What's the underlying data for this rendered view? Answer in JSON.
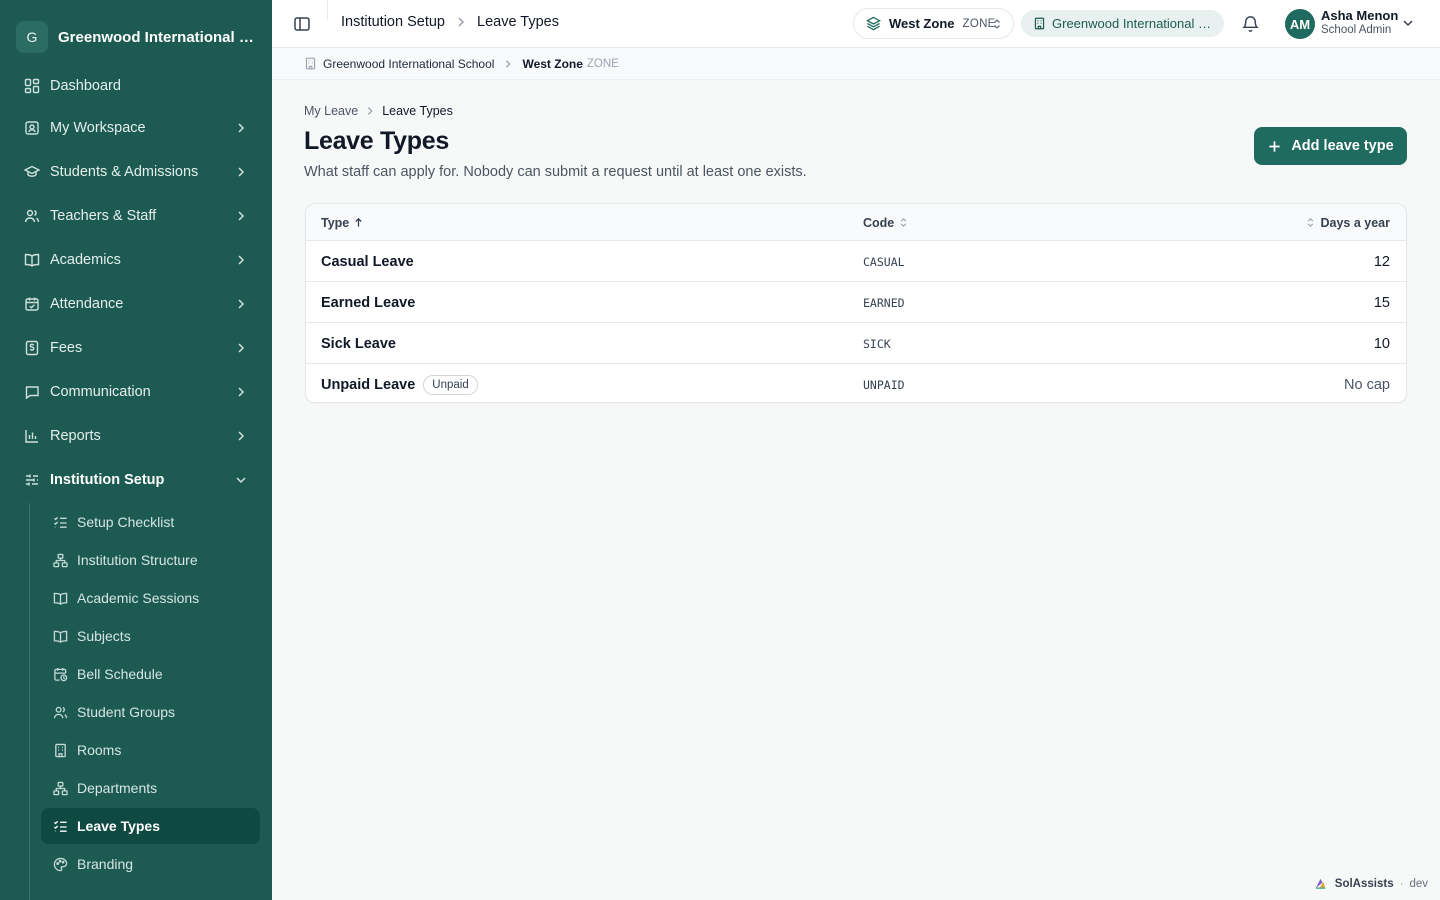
{
  "sidebar": {
    "logo_letter": "G",
    "school_name": "Greenwood International School",
    "items": [
      {
        "label": "Dashboard",
        "icon": "dashboard-icon"
      },
      {
        "label": "My Workspace",
        "icon": "badge-icon"
      },
      {
        "label": "Students & Admissions",
        "icon": "graduation-cap-icon"
      },
      {
        "label": "Teachers & Staff",
        "icon": "users-icon"
      },
      {
        "label": "Academics",
        "icon": "book-icon"
      },
      {
        "label": "Attendance",
        "icon": "calendar-check-icon"
      },
      {
        "label": "Fees",
        "icon": "dollar-receipt-icon"
      },
      {
        "label": "Communication",
        "icon": "message-icon"
      },
      {
        "label": "Reports",
        "icon": "bar-chart-icon"
      },
      {
        "label": "Institution Setup",
        "icon": "sliders-icon",
        "expanded": true
      }
    ],
    "sub_items": [
      {
        "label": "Setup Checklist",
        "icon": "list-checks-icon"
      },
      {
        "label": "Institution Structure",
        "icon": "hierarchy-icon"
      },
      {
        "label": "Academic Sessions",
        "icon": "book-icon"
      },
      {
        "label": "Subjects",
        "icon": "book-icon"
      },
      {
        "label": "Bell Schedule",
        "icon": "calendar-clock-icon"
      },
      {
        "label": "Student Groups",
        "icon": "users-icon"
      },
      {
        "label": "Rooms",
        "icon": "building-icon"
      },
      {
        "label": "Departments",
        "icon": "hierarchy-icon"
      },
      {
        "label": "Leave Types",
        "icon": "list-checks-icon",
        "active": true
      },
      {
        "label": "Branding",
        "icon": "palette-icon"
      }
    ]
  },
  "topbar": {
    "breadcrumb": [
      "Institution Setup",
      "Leave Types"
    ],
    "zone_name": "West Zone",
    "zone_tag": "ZONE",
    "school_pill": "Greenwood International School",
    "user_initials": "AM",
    "user_name": "Asha Menon",
    "user_role": "School Admin"
  },
  "scope": {
    "school": "Greenwood International School",
    "zone": "West Zone",
    "zone_tag": "ZONE"
  },
  "page": {
    "breadcrumb": [
      "My Leave",
      "Leave Types"
    ],
    "title": "Leave Types",
    "subtitle": "What staff can apply for. Nobody can submit a request until at least one exists.",
    "add_button": "Add leave type"
  },
  "table": {
    "columns": {
      "type": "Type",
      "code": "Code",
      "days": "Days a year"
    },
    "sort": {
      "column": "type",
      "direction": "ascending"
    },
    "rows": [
      {
        "type": "Casual Leave",
        "code": "CASUAL",
        "days": "12",
        "badge": null
      },
      {
        "type": "Earned Leave",
        "code": "EARNED",
        "days": "15",
        "badge": null
      },
      {
        "type": "Sick Leave",
        "code": "SICK",
        "days": "10",
        "badge": null
      },
      {
        "type": "Unpaid Leave",
        "code": "UNPAID",
        "days": "No cap",
        "badge": "Unpaid"
      }
    ]
  },
  "footer": {
    "brand": "SolAssists",
    "env": "dev"
  },
  "colors": {
    "sidebar_bg": "#1d5b52",
    "sidebar_active": "#0f4a42",
    "accent": "#1f6b5f"
  }
}
